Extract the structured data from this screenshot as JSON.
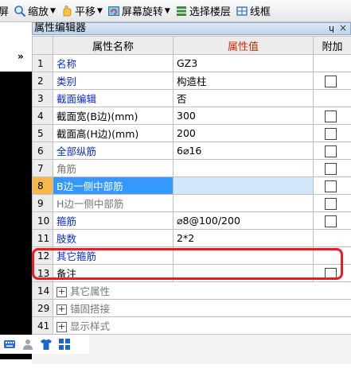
{
  "toolbar": {
    "items": [
      {
        "label": "屏",
        "icon": "zoom-window-icon",
        "caret": false
      },
      {
        "label": "缩放",
        "icon": "zoom-icon",
        "caret": true
      },
      {
        "label": "平移",
        "icon": "pan-icon",
        "caret": true
      },
      {
        "label": "屏幕旋转",
        "icon": "rotate-icon",
        "caret": true
      },
      {
        "label": "选择楼层",
        "icon": "floor-icon",
        "caret": false
      },
      {
        "label": "线框",
        "icon": "wireframe-icon",
        "caret": false
      }
    ]
  },
  "panel": {
    "title": "属性编辑器",
    "pin": "ɥ",
    "close": "×"
  },
  "grid": {
    "headers": {
      "num": "",
      "name": "属性名称",
      "value": "属性值",
      "extra": "附加"
    },
    "rows": [
      {
        "num": "1",
        "name": "名称",
        "value": "GZ3",
        "name_style": "blue",
        "checkbox": false,
        "expand": false
      },
      {
        "num": "2",
        "name": "类别",
        "value": "构造柱",
        "name_style": "blue",
        "checkbox": true,
        "expand": false
      },
      {
        "num": "3",
        "name": "截面编辑",
        "value": "否",
        "name_style": "blue",
        "checkbox": false,
        "expand": false
      },
      {
        "num": "4",
        "name": "截面宽(B边)(mm)",
        "value": "300",
        "name_style": "black",
        "checkbox": true,
        "expand": false
      },
      {
        "num": "5",
        "name": "截面高(H边)(mm)",
        "value": "200",
        "name_style": "black",
        "checkbox": true,
        "expand": false
      },
      {
        "num": "6",
        "name": "全部纵筋",
        "value": "6⌀16",
        "name_style": "blue",
        "checkbox": true,
        "expand": false
      },
      {
        "num": "7",
        "name": "角筋",
        "value": "",
        "name_style": "gray",
        "checkbox": true,
        "expand": false
      },
      {
        "num": "8",
        "name": "B边一侧中部筋",
        "value": "",
        "name_style": "selected",
        "checkbox": true,
        "expand": false
      },
      {
        "num": "9",
        "name": "H边一侧中部筋",
        "value": "",
        "name_style": "gray",
        "checkbox": true,
        "expand": false
      },
      {
        "num": "10",
        "name": "箍筋",
        "value": "⌀8@100/200",
        "name_style": "blue",
        "checkbox": true,
        "expand": false
      },
      {
        "num": "11",
        "name": "肢数",
        "value": "2*2",
        "name_style": "blue",
        "checkbox": false,
        "expand": false
      },
      {
        "num": "12",
        "name": "其它箍筋",
        "value": "",
        "name_style": "blue",
        "checkbox": false,
        "expand": false
      },
      {
        "num": "13",
        "name": "备注",
        "value": "",
        "name_style": "black",
        "checkbox": true,
        "expand": false
      },
      {
        "num": "14",
        "name": "其它属性",
        "value": "",
        "name_style": "group",
        "checkbox": false,
        "expand": true
      },
      {
        "num": "29",
        "name": "锚固搭接",
        "value": "",
        "name_style": "group",
        "checkbox": false,
        "expand": true
      },
      {
        "num": "41",
        "name": "显示样式",
        "value": "",
        "name_style": "group",
        "checkbox": false,
        "expand": true
      }
    ]
  },
  "left": {
    "collapse_glyph": "»"
  },
  "floatbar": {
    "icons": [
      "keyboard-icon",
      "user-icon",
      "shirt-icon",
      "grid-apps-icon"
    ]
  },
  "colors": {
    "highlight": "#ee1c24",
    "selected_name_bg": "#3399ff",
    "link_blue": "#0a2bd6",
    "header_value": "#d42b00"
  }
}
